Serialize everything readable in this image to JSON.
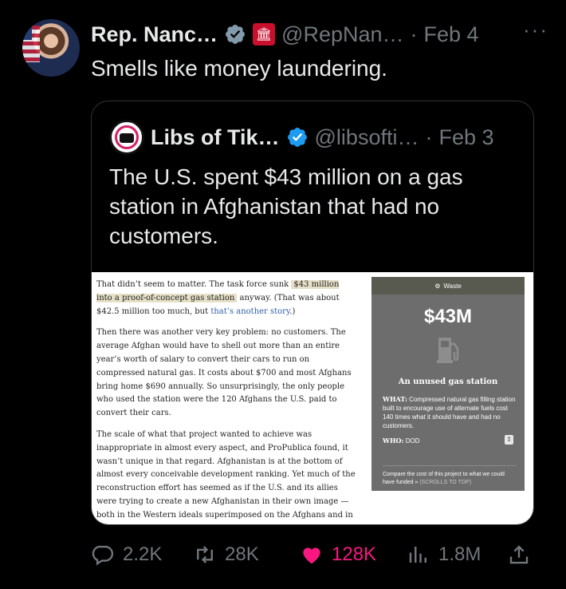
{
  "tweet": {
    "author_name": "Rep. Nanc…",
    "handle": "@RepNan…",
    "separator": "·",
    "date": "Feb 4",
    "more": "···",
    "text": "Smells like money laundering."
  },
  "quoted": {
    "author_name": "Libs of Tik…",
    "avatar_text": "Libs of TikTok",
    "handle": "@libsofti…",
    "separator": "·",
    "date": "Feb 3",
    "text": "The U.S. spent $43 million on a gas station in Afghanistan that had no customers."
  },
  "article": {
    "p1_before": "That didn’t seem to matter. The task force sunk ",
    "p1_highlight": "$43 million into a proof-of-concept gas station",
    "p1_mid": " anyway. (That was about $42.5 million too much, but ",
    "p1_link": "that’s another story",
    "p1_after": ".)",
    "p2": "Then there was another very key problem: no customers. The average Afghan would have to shell out more than an entire year’s worth of salary to convert their cars to run on compressed natural gas. It costs about $700 and most Afghans bring home $690 annually. So unsurprisingly, the only people who used the station were the 120 Afghans the U.S. paid to convert their cars.",
    "p3": "The scale of what that project wanted to achieve was inappropriate in almost every aspect, and ProPublica found, it wasn’t unique in that regard. Afghanistan is at the bottom of almost every conceivable development ranking. Yet much of the reconstruction effort has seemed as if the U.S. and its allies were trying to create a new Afghanistan in their own image — both in the Western ideals superimposed on the Afghans and in the sheer ambition of the projects."
  },
  "card": {
    "category": "Waste",
    "amount": "$43M",
    "title": "An unused gas station",
    "what_label": "WHAT:",
    "what_text": "Compressed natural gas filling station built to encourage use of alternate fuels cost 140 times what it should have and had no customers.",
    "who_label": "WHO:",
    "who_text": "DOD",
    "footer_text": "Compare the cost of this project to what we could have funded »",
    "footer_scroll": "(SCROLLS TO TOP)"
  },
  "actions": {
    "replies": "2.2K",
    "retweets": "28K",
    "likes": "128K",
    "views": "1.8M"
  },
  "colors": {
    "background": "#000000",
    "text": "#e7e9ea",
    "muted": "#71767b",
    "verified": "#1d9bf0",
    "like": "#f91880"
  }
}
